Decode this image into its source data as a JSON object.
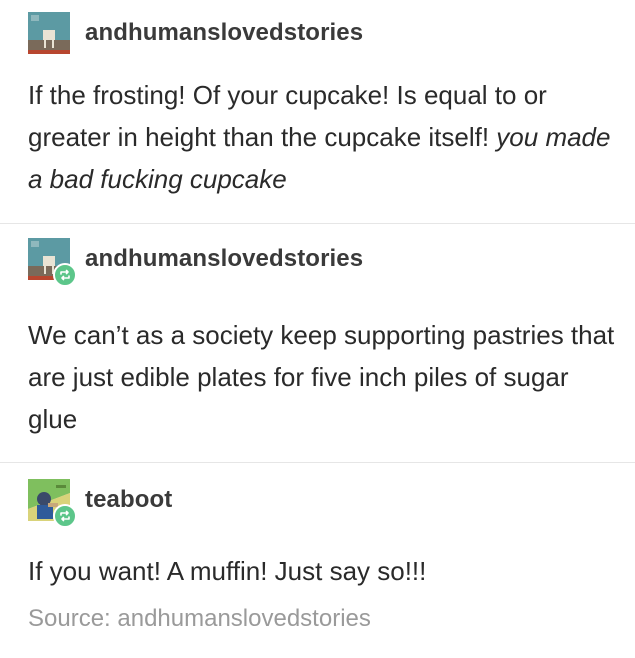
{
  "posts": [
    {
      "username": "andhumanslovedstories",
      "reblogged": false,
      "text_plain": "If the frosting! Of your cupcake! Is equal to or greater in height than the cupcake itself! ",
      "text_italic": "you made a bad fucking cupcake"
    },
    {
      "username": "andhumanslovedstories",
      "reblogged": true,
      "text_plain": "We can’t as a society keep supporting pastries that are just edible plates for five inch piles of sugar glue"
    },
    {
      "username": "teaboot",
      "reblogged": true,
      "text_plain": "If you want! A muffin! Just say so!!!"
    }
  ],
  "source": {
    "label": "Source: andhumanslovedstories"
  },
  "icons": {
    "reblog_badge": "reblog-icon",
    "colors": {
      "reblog_green": "#5cc68a"
    }
  }
}
